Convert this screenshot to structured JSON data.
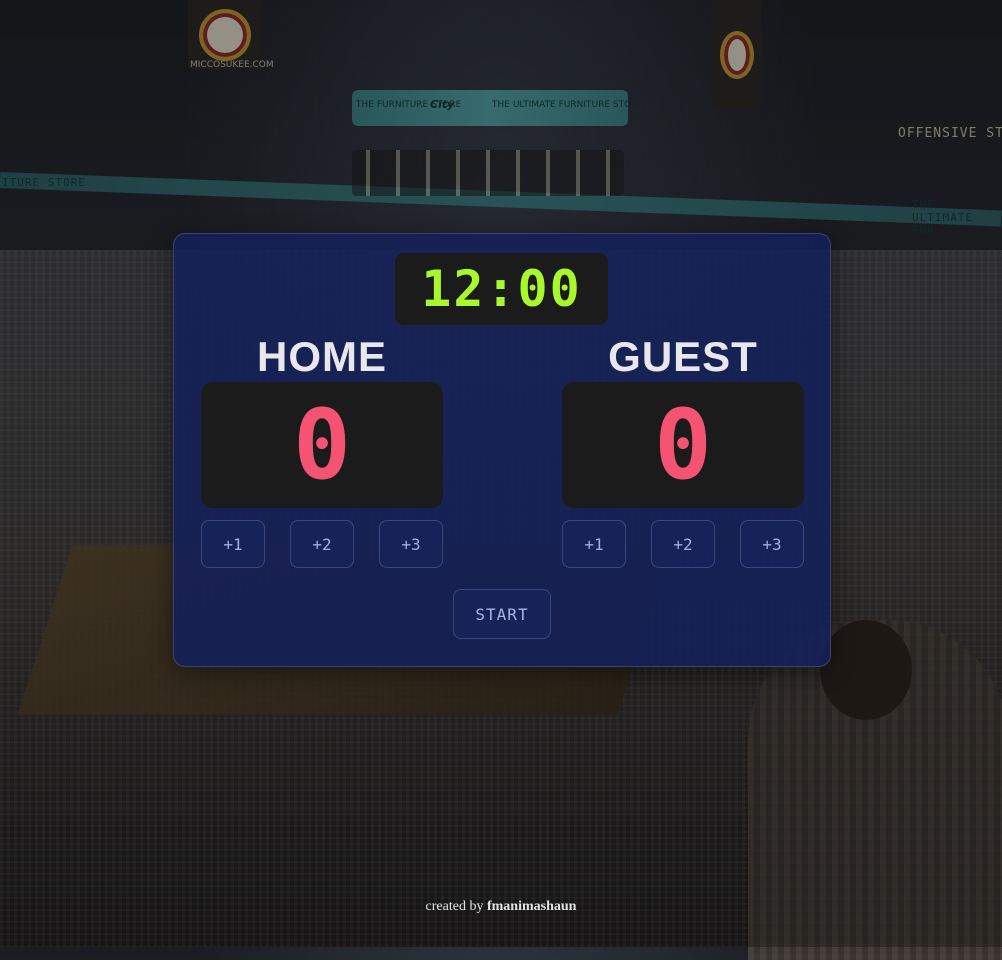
{
  "background": {
    "banner_text": "MICCOSUKEE.COM",
    "jumbotron_left": "THE FURNITURE STORE",
    "jumbotron_center": "City",
    "jumbotron_right": "THE ULTIMATE FURNITURE STORE",
    "ribbon_left": "ITURE STORE",
    "ribbon_right": "THE ULTIMATE FUR",
    "offensive_text": "OFFENSIVE STA"
  },
  "timer": {
    "value": "12:00",
    "color": "#a8f82c"
  },
  "home": {
    "name": "HOME",
    "score": "0",
    "buttons": [
      "+1",
      "+2",
      "+3"
    ]
  },
  "guest": {
    "name": "GUEST",
    "score": "0",
    "buttons": [
      "+1",
      "+2",
      "+3"
    ]
  },
  "start_label": "START",
  "credit": {
    "prefix": "created by",
    "author": "fmanimashaun"
  },
  "colors": {
    "board": "#132059",
    "score": "#f55372",
    "timer": "#a8f82c",
    "display_bg": "#1b1b1b"
  }
}
